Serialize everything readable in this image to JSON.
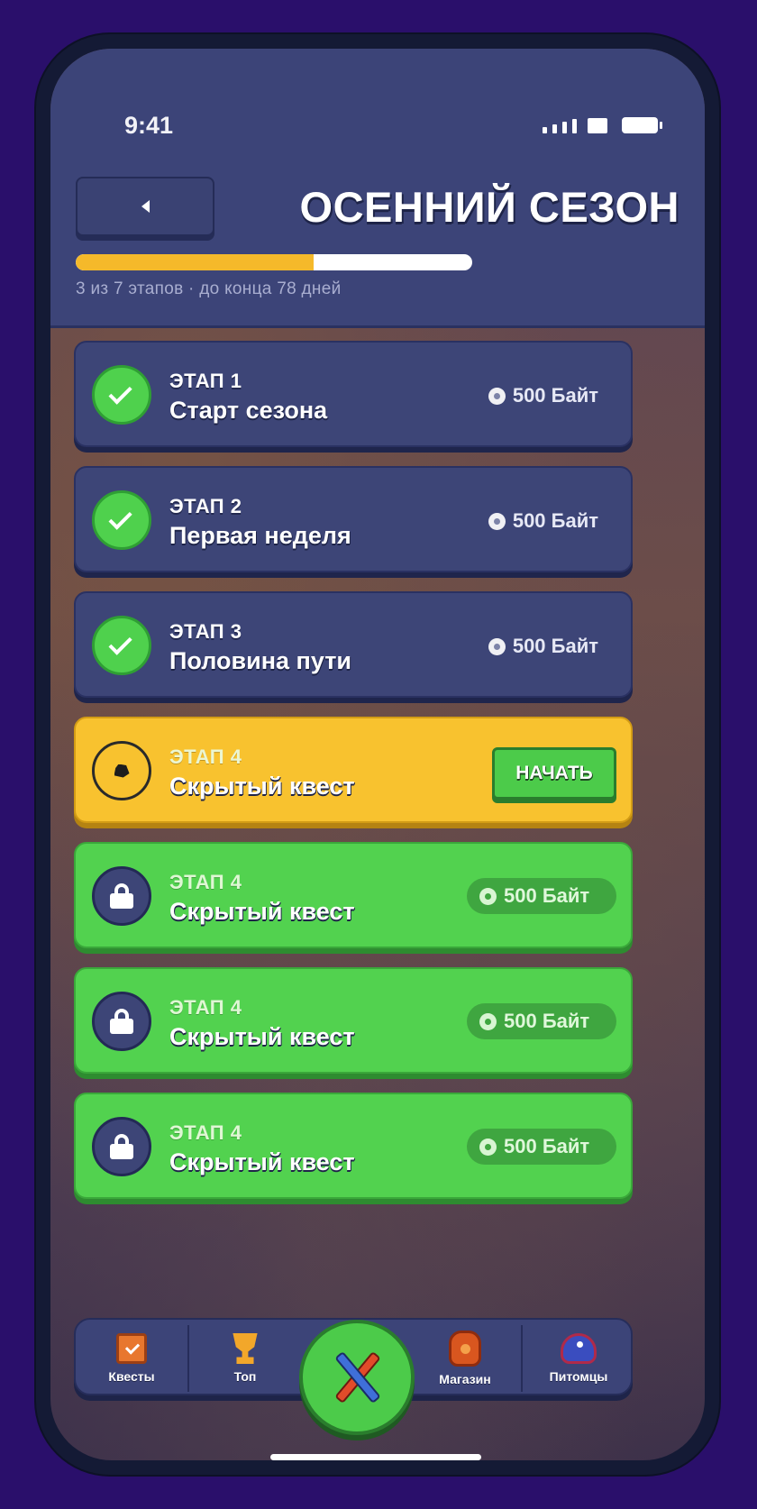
{
  "status_bar": {
    "time": "9:41"
  },
  "header": {
    "title": "ОСЕННИЙ СЕЗОН",
    "progress": 0.6,
    "caption": "3 из 7 этапов · до конца 78 дней"
  },
  "stages": [
    {
      "num": "ЭТАП 1",
      "name": "Старт сезона",
      "reward": "500 Байт",
      "state": "done"
    },
    {
      "num": "ЭТАП 2",
      "name": "Первая неделя",
      "reward": "500 Байт",
      "state": "done"
    },
    {
      "num": "ЭТАП 3",
      "name": "Половина пути",
      "reward": "500 Байт",
      "state": "done"
    },
    {
      "num": "ЭТАП 4",
      "name": "Скрытый квест",
      "action": "НАЧАТЬ",
      "state": "active"
    },
    {
      "num": "ЭТАП 4",
      "name": "Скрытый квест",
      "reward": "500 Байт",
      "state": "locked"
    },
    {
      "num": "ЭТАП 4",
      "name": "Скрытый квест",
      "reward": "500 Байт",
      "state": "locked"
    },
    {
      "num": "ЭТАП 4",
      "name": "Скрытый квест",
      "reward": "500 Байт",
      "state": "locked"
    }
  ],
  "tabbar": {
    "tabs": [
      {
        "label": "Квесты",
        "icon": "calendar-check-icon"
      },
      {
        "label": "Топ",
        "icon": "trophy-icon"
      },
      {
        "label": "Магазин",
        "icon": "bag-icon"
      },
      {
        "label": "Питомцы",
        "icon": "pet-icon"
      }
    ],
    "center_icon": "crossed-swords-icon"
  },
  "colors": {
    "background": "#2a0f6b",
    "header": "#3c4478",
    "done_card": "#3d4577",
    "active_card": "#f8c22f",
    "locked_card": "#52d24f",
    "progress_fill": "#f5b92a"
  }
}
